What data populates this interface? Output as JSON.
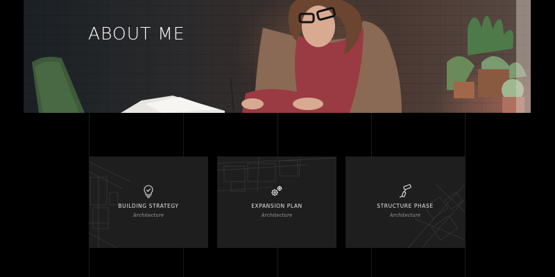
{
  "hero": {
    "title": "ABOUT ME"
  },
  "services": [
    {
      "title": "BUILDING STRATEGY",
      "subtitle": "Architecture",
      "icon": "lightbulb-icon"
    },
    {
      "title": "EXPANSION PLAN",
      "subtitle": "Architecture",
      "icon": "gears-icon"
    },
    {
      "title": "STRUCTURE PHASE",
      "subtitle": "Architecture",
      "icon": "paint-roller-icon"
    }
  ],
  "colors": {
    "background": "#000000",
    "card": "#1e1e1e",
    "text": "#e6e6e6",
    "muted": "#9a9a9a"
  }
}
